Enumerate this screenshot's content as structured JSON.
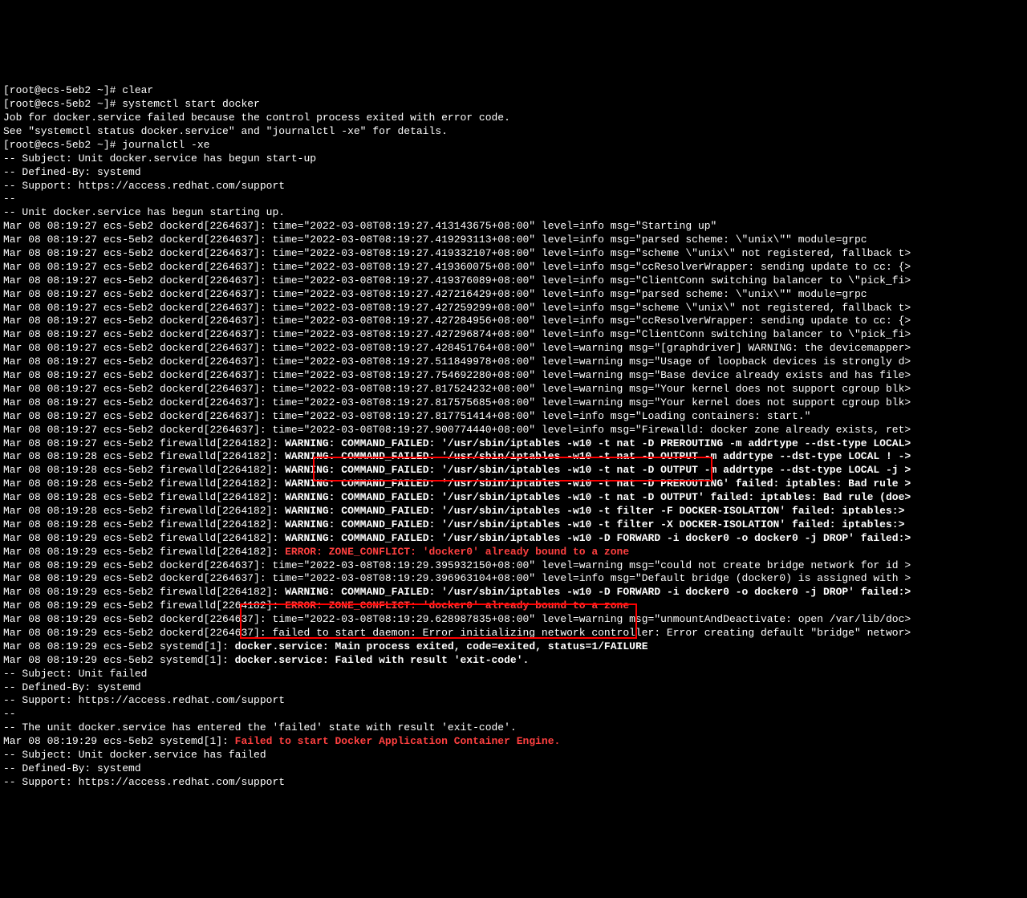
{
  "lines": [
    {
      "cls": "white",
      "text": "[root@ecs-5eb2 ~]# clear"
    },
    {
      "cls": "white",
      "text": "[root@ecs-5eb2 ~]# systemctl start docker"
    },
    {
      "cls": "white",
      "text": "Job for docker.service failed because the control process exited with error code."
    },
    {
      "cls": "white",
      "text": "See \"systemctl status docker.service\" and \"journalctl -xe\" for details."
    },
    {
      "cls": "white",
      "text": "[root@ecs-5eb2 ~]# journalctl -xe"
    },
    {
      "cls": "white",
      "text": "-- Subject: Unit docker.service has begun start-up"
    },
    {
      "cls": "white",
      "text": "-- Defined-By: systemd"
    },
    {
      "cls": "white",
      "text": "-- Support: https://access.redhat.com/support"
    },
    {
      "cls": "white",
      "text": "-- "
    },
    {
      "cls": "white",
      "text": "-- Unit docker.service has begun starting up."
    },
    {
      "cls": "white",
      "text": "Mar 08 08:19:27 ecs-5eb2 dockerd[2264637]: time=\"2022-03-08T08:19:27.413143675+08:00\" level=info msg=\"Starting up\""
    },
    {
      "cls": "white",
      "text": "Mar 08 08:19:27 ecs-5eb2 dockerd[2264637]: time=\"2022-03-08T08:19:27.419293113+08:00\" level=info msg=\"parsed scheme: \\\"unix\\\"\" module=grpc"
    },
    {
      "cls": "white",
      "text": "Mar 08 08:19:27 ecs-5eb2 dockerd[2264637]: time=\"2022-03-08T08:19:27.419332107+08:00\" level=info msg=\"scheme \\\"unix\\\" not registered, fallback t>"
    },
    {
      "cls": "white",
      "text": "Mar 08 08:19:27 ecs-5eb2 dockerd[2264637]: time=\"2022-03-08T08:19:27.419360075+08:00\" level=info msg=\"ccResolverWrapper: sending update to cc: {>"
    },
    {
      "cls": "white",
      "text": "Mar 08 08:19:27 ecs-5eb2 dockerd[2264637]: time=\"2022-03-08T08:19:27.419376089+08:00\" level=info msg=\"ClientConn switching balancer to \\\"pick_fi>"
    },
    {
      "cls": "white",
      "text": "Mar 08 08:19:27 ecs-5eb2 dockerd[2264637]: time=\"2022-03-08T08:19:27.427216429+08:00\" level=info msg=\"parsed scheme: \\\"unix\\\"\" module=grpc"
    },
    {
      "cls": "white",
      "text": "Mar 08 08:19:27 ecs-5eb2 dockerd[2264637]: time=\"2022-03-08T08:19:27.427259299+08:00\" level=info msg=\"scheme \\\"unix\\\" not registered, fallback t>"
    },
    {
      "cls": "white",
      "text": "Mar 08 08:19:27 ecs-5eb2 dockerd[2264637]: time=\"2022-03-08T08:19:27.427284956+08:00\" level=info msg=\"ccResolverWrapper: sending update to cc: {>"
    },
    {
      "cls": "white",
      "text": "Mar 08 08:19:27 ecs-5eb2 dockerd[2264637]: time=\"2022-03-08T08:19:27.427296874+08:00\" level=info msg=\"ClientConn switching balancer to \\\"pick_fi>"
    },
    {
      "cls": "white",
      "text": "Mar 08 08:19:27 ecs-5eb2 dockerd[2264637]: time=\"2022-03-08T08:19:27.428451764+08:00\" level=warning msg=\"[graphdriver] WARNING: the devicemapper>"
    },
    {
      "cls": "white",
      "text": "Mar 08 08:19:27 ecs-5eb2 dockerd[2264637]: time=\"2022-03-08T08:19:27.511849978+08:00\" level=warning msg=\"Usage of loopback devices is strongly d>"
    },
    {
      "cls": "white",
      "text": "Mar 08 08:19:27 ecs-5eb2 dockerd[2264637]: time=\"2022-03-08T08:19:27.754692280+08:00\" level=warning msg=\"Base device already exists and has file>"
    },
    {
      "cls": "white",
      "text": "Mar 08 08:19:27 ecs-5eb2 dockerd[2264637]: time=\"2022-03-08T08:19:27.817524232+08:00\" level=warning msg=\"Your kernel does not support cgroup blk>"
    },
    {
      "cls": "white",
      "text": "Mar 08 08:19:27 ecs-5eb2 dockerd[2264637]: time=\"2022-03-08T08:19:27.817575685+08:00\" level=warning msg=\"Your kernel does not support cgroup blk>"
    },
    {
      "cls": "white",
      "text": "Mar 08 08:19:27 ecs-5eb2 dockerd[2264637]: time=\"2022-03-08T08:19:27.817751414+08:00\" level=info msg=\"Loading containers: start.\""
    },
    {
      "cls": "white",
      "text": "Mar 08 08:19:27 ecs-5eb2 dockerd[2264637]: time=\"2022-03-08T08:19:27.900774440+08:00\" level=info msg=\"Firewalld: docker zone already exists, ret>"
    },
    {
      "segments": [
        {
          "cls": "white",
          "text": "Mar 08 08:19:27 ecs-5eb2 firewalld[2264182]: "
        },
        {
          "cls": "bold-white",
          "text": "WARNING: COMMAND_FAILED: '/usr/sbin/iptables -w10 -t nat -D PREROUTING -m addrtype --dst-type LOCAL>"
        }
      ]
    },
    {
      "segments": [
        {
          "cls": "white",
          "text": "Mar 08 08:19:28 ecs-5eb2 firewalld[2264182]: "
        },
        {
          "cls": "bold-white",
          "text": "WARNING: COMMAND_FAILED: '/usr/sbin/iptables -w10 -t nat -D OUTPUT -m addrtype --dst-type LOCAL ! ->"
        }
      ]
    },
    {
      "segments": [
        {
          "cls": "white",
          "text": "Mar 08 08:19:28 ecs-5eb2 firewalld[2264182]: "
        },
        {
          "cls": "bold-white",
          "text": "WARNING: COMMAND_FAILED: '/usr/sbin/iptables -w10 -t nat -D OUTPUT -m addrtype --dst-type LOCAL -j >"
        }
      ]
    },
    {
      "segments": [
        {
          "cls": "white",
          "text": "Mar 08 08:19:28 ecs-5eb2 firewalld[2264182]: "
        },
        {
          "cls": "bold-white",
          "text": "WARNING: COMMAND_FAILED: '/usr/sbin/iptables -w10 -t nat -D PREROUTING' failed: iptables: Bad rule >"
        }
      ]
    },
    {
      "segments": [
        {
          "cls": "white",
          "text": "Mar 08 08:19:28 ecs-5eb2 firewalld[2264182]: "
        },
        {
          "cls": "bold-white",
          "text": "WARNING: COMMAND_FAILED: '/usr/sbin/iptables -w10 -t nat -D OUTPUT' failed: iptables: Bad rule (doe>"
        }
      ]
    },
    {
      "segments": [
        {
          "cls": "white",
          "text": "Mar 08 08:19:28 ecs-5eb2 firewalld[2264182]: "
        },
        {
          "cls": "bold-white",
          "text": "WARNING: COMMAND_FAILED: '/usr/sbin/iptables -w10 -t filter -F DOCKER-ISOLATION' failed: iptables:>"
        }
      ]
    },
    {
      "segments": [
        {
          "cls": "white",
          "text": "Mar 08 08:19:28 ecs-5eb2 firewalld[2264182]: "
        },
        {
          "cls": "bold-white",
          "text": "WARNING: COMMAND_FAILED: '/usr/sbin/iptables -w10 -t filter -X DOCKER-ISOLATION' failed: iptables:>"
        }
      ]
    },
    {
      "segments": [
        {
          "cls": "white",
          "text": "Mar 08 08:19:29 ecs-5eb2 firewalld[2264182]: "
        },
        {
          "cls": "bold-white",
          "text": "WARNING: COMMAND_FAILED: '/usr/sbin/iptables -w10 -D FORWARD -i docker0 -o docker0 -j DROP' failed:>"
        }
      ]
    },
    {
      "segments": [
        {
          "cls": "white",
          "text": "Mar 08 08:19:29 ecs-5eb2 firewalld[2264182]: "
        },
        {
          "cls": "red",
          "text": "ERROR: ZONE_CONFLICT: 'docker0' already bound to a zone"
        }
      ]
    },
    {
      "cls": "white",
      "text": "Mar 08 08:19:29 ecs-5eb2 dockerd[2264637]: time=\"2022-03-08T08:19:29.395932150+08:00\" level=warning msg=\"could not create bridge network for id >"
    },
    {
      "cls": "white",
      "text": "Mar 08 08:19:29 ecs-5eb2 dockerd[2264637]: time=\"2022-03-08T08:19:29.396963104+08:00\" level=info msg=\"Default bridge (docker0) is assigned with >"
    },
    {
      "segments": [
        {
          "cls": "white",
          "text": "Mar 08 08:19:29 ecs-5eb2 firewalld[2264182]: "
        },
        {
          "cls": "bold-white",
          "text": "WARNING: COMMAND_FAILED: '/usr/sbin/iptables -w10 -D FORWARD -i docker0 -o docker0 -j DROP' failed:>"
        }
      ]
    },
    {
      "segments": [
        {
          "cls": "white",
          "text": "Mar 08 08:19:29 ecs-5eb2 firewalld[2264182]: "
        },
        {
          "cls": "red",
          "text": "ERROR: ZONE_CONFLICT: 'docker0' already bound to a zone"
        }
      ]
    },
    {
      "cls": "white",
      "text": "Mar 08 08:19:29 ecs-5eb2 dockerd[2264637]: time=\"2022-03-08T08:19:29.628987835+08:00\" level=warning msg=\"unmountAndDeactivate: open /var/lib/doc>"
    },
    {
      "cls": "white",
      "text": "Mar 08 08:19:29 ecs-5eb2 dockerd[2264637]: failed to start daemon: Error initializing network controller: Error creating default \"bridge\" networ>"
    },
    {
      "segments": [
        {
          "cls": "white",
          "text": "Mar 08 08:19:29 ecs-5eb2 systemd[1]: "
        },
        {
          "cls": "bold-white",
          "text": "docker.service: Main process exited, code=exited, status=1/FAILURE"
        }
      ]
    },
    {
      "segments": [
        {
          "cls": "white",
          "text": "Mar 08 08:19:29 ecs-5eb2 systemd[1]: "
        },
        {
          "cls": "bold-white",
          "text": "docker.service: Failed with result 'exit-code'."
        }
      ]
    },
    {
      "cls": "white",
      "text": "-- Subject: Unit failed"
    },
    {
      "cls": "white",
      "text": "-- Defined-By: systemd"
    },
    {
      "cls": "white",
      "text": "-- Support: https://access.redhat.com/support"
    },
    {
      "cls": "white",
      "text": "-- "
    },
    {
      "cls": "white",
      "text": "-- The unit docker.service has entered the 'failed' state with result 'exit-code'."
    },
    {
      "segments": [
        {
          "cls": "white",
          "text": "Mar 08 08:19:29 ecs-5eb2 systemd[1]: "
        },
        {
          "cls": "red",
          "text": "Failed to start Docker Application Container Engine."
        }
      ]
    },
    {
      "cls": "white",
      "text": "-- Subject: Unit docker.service has failed"
    },
    {
      "cls": "white",
      "text": "-- Defined-By: systemd"
    },
    {
      "cls": "white",
      "text": "-- Support: https://access.redhat.com/support"
    }
  ]
}
